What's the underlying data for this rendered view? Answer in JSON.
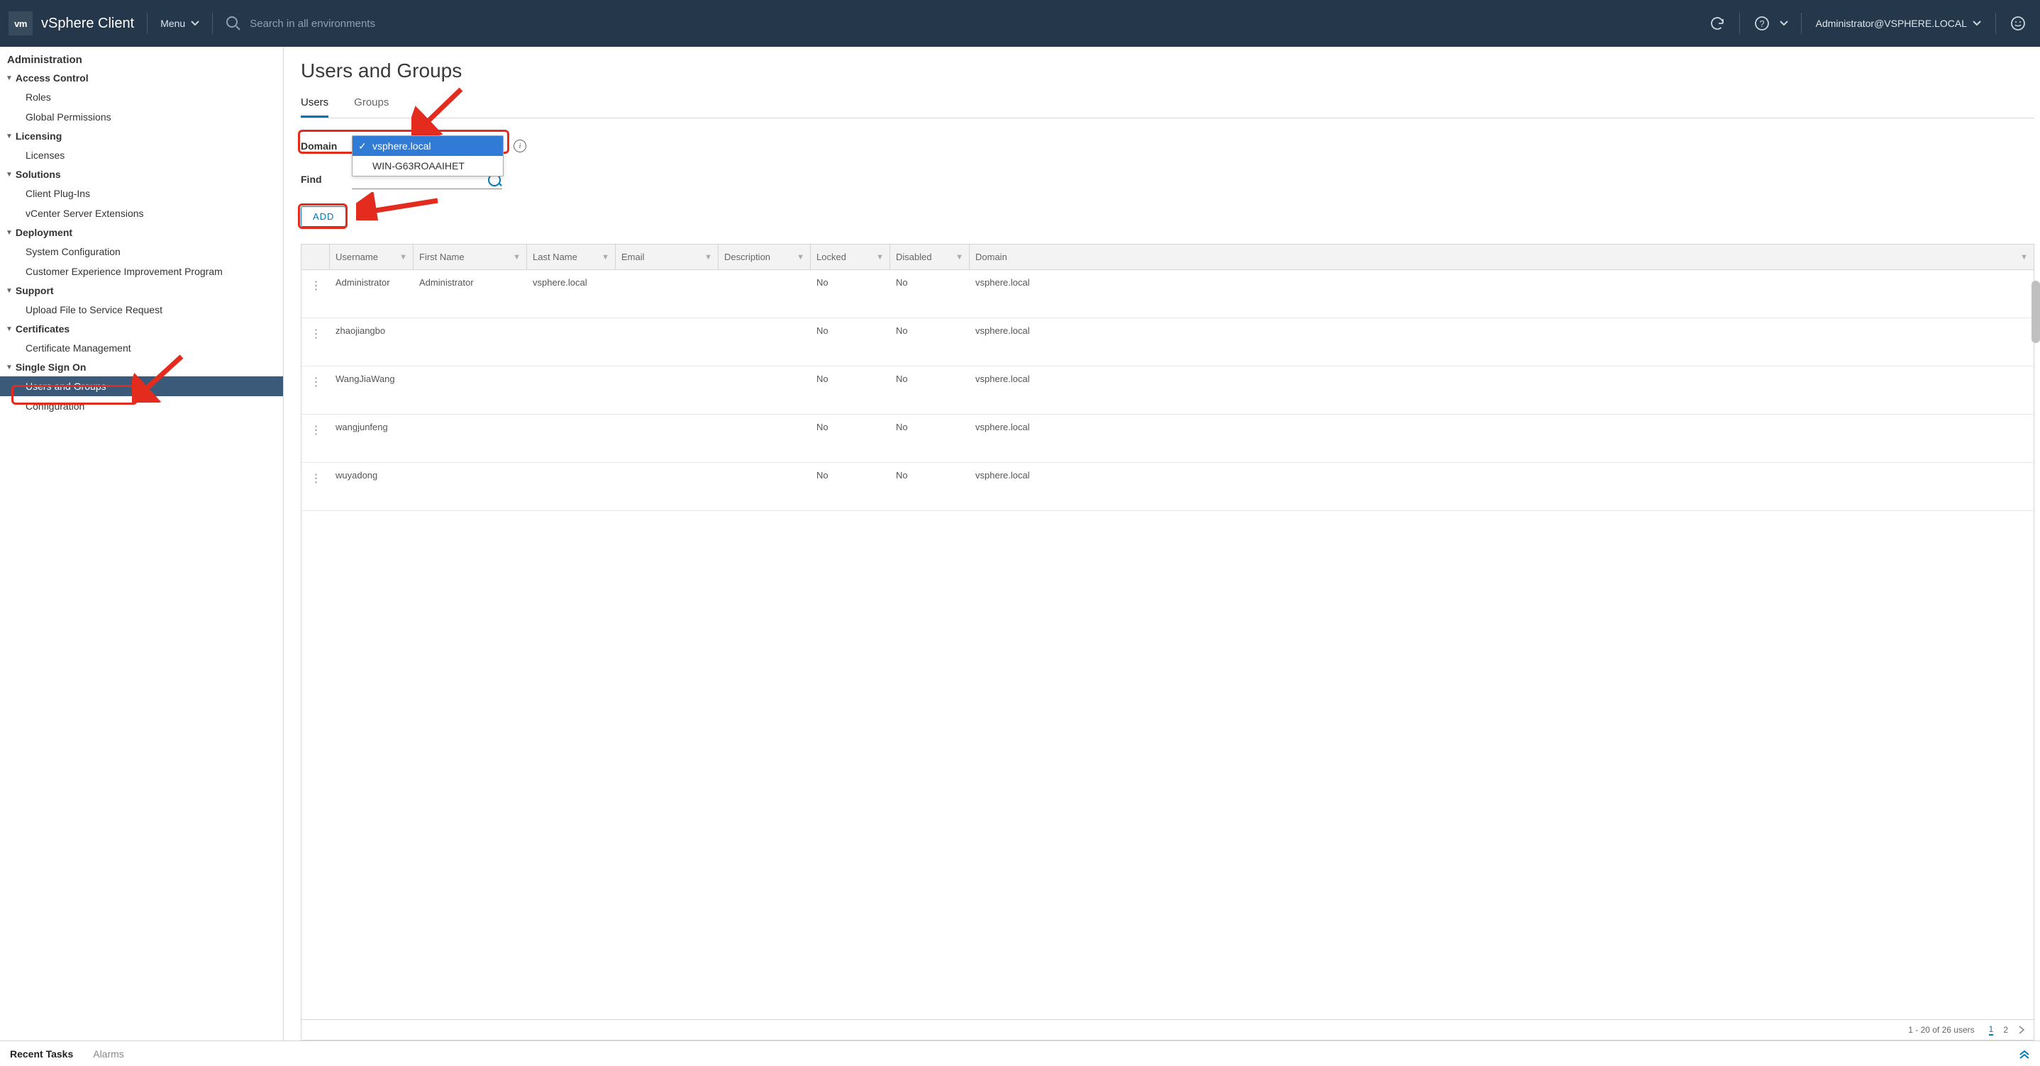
{
  "topbar": {
    "logo_text": "vm",
    "product": "vSphere Client",
    "menu_label": "Menu",
    "search_placeholder": "Search in all environments",
    "user_label": "Administrator@VSPHERE.LOCAL"
  },
  "sidebar": {
    "root": "Administration",
    "sections": [
      {
        "label": "Access Control",
        "items": [
          "Roles",
          "Global Permissions"
        ]
      },
      {
        "label": "Licensing",
        "items": [
          "Licenses"
        ]
      },
      {
        "label": "Solutions",
        "items": [
          "Client Plug-Ins",
          "vCenter Server Extensions"
        ]
      },
      {
        "label": "Deployment",
        "items": [
          "System Configuration",
          "Customer Experience Improvement Program"
        ]
      },
      {
        "label": "Support",
        "items": [
          "Upload File to Service Request"
        ]
      },
      {
        "label": "Certificates",
        "items": [
          "Certificate Management"
        ]
      },
      {
        "label": "Single Sign On",
        "items": [
          "Users and Groups",
          "Configuration"
        ]
      }
    ],
    "active_item": "Users and Groups"
  },
  "main": {
    "title": "Users and Groups",
    "tabs": {
      "users": "Users",
      "groups": "Groups",
      "active": "Users"
    },
    "filters": {
      "domain_label": "Domain",
      "domain_options": [
        "vsphere.local",
        "WIN-G63ROAAIHET"
      ],
      "domain_selected": "vsphere.local",
      "find_label": "Find"
    },
    "add_button": "ADD",
    "table": {
      "columns": [
        "Username",
        "First Name",
        "Last Name",
        "Email",
        "Description",
        "Locked",
        "Disabled",
        "Domain"
      ],
      "rows": [
        {
          "username": "Administrator",
          "first": "Administrator",
          "last": "vsphere.local",
          "email": "",
          "desc": "",
          "locked": "No",
          "disabled": "No",
          "domain": "vsphere.local"
        },
        {
          "username": "zhaojiangbo",
          "first": "",
          "last": "",
          "email": "",
          "desc": "",
          "locked": "No",
          "disabled": "No",
          "domain": "vsphere.local"
        },
        {
          "username": "WangJiaWang",
          "first": "",
          "last": "",
          "email": "",
          "desc": "",
          "locked": "No",
          "disabled": "No",
          "domain": "vsphere.local"
        },
        {
          "username": "wangjunfeng",
          "first": "",
          "last": "",
          "email": "",
          "desc": "",
          "locked": "No",
          "disabled": "No",
          "domain": "vsphere.local"
        },
        {
          "username": "wuyadong",
          "first": "",
          "last": "",
          "email": "",
          "desc": "",
          "locked": "No",
          "disabled": "No",
          "domain": "vsphere.local"
        }
      ],
      "footer_text": "1 - 20 of 26 users",
      "page_current": "1",
      "page_other": "2"
    }
  },
  "bottombar": {
    "recent_tasks": "Recent Tasks",
    "alarms": "Alarms"
  }
}
